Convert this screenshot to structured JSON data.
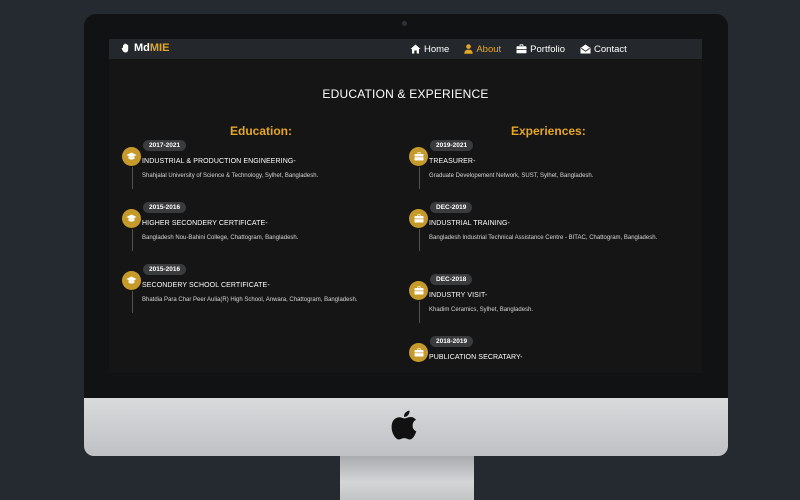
{
  "brand": {
    "prefix": "Md",
    "accent_text": "MIE",
    "icon": "hand-icon"
  },
  "nav": [
    {
      "label": "Home",
      "icon": "home-icon",
      "active": false
    },
    {
      "label": "About",
      "icon": "user-icon",
      "active": true
    },
    {
      "label": "Portfolio",
      "icon": "briefcase-icon",
      "active": false
    },
    {
      "label": "Contact",
      "icon": "envelope-open-icon",
      "active": false
    }
  ],
  "section_title": "EDUCATION & EXPERIENCE",
  "education": {
    "heading": "Education:",
    "items": [
      {
        "date": "2017-2021",
        "title": "INDUSTRIAL & PRODUCTION ENGINEERING-",
        "desc": "Shahjalal University of Science & Technology, Sylhet, Bangladesh.",
        "icon": "graduation-cap-icon"
      },
      {
        "date": "2015-2016",
        "title": "HIGHER SECONDERY CERTIFICATE-",
        "desc": "Bangladesh Nou-Bahini College, Chattogram, Bangladesh.",
        "icon": "graduation-cap-icon"
      },
      {
        "date": "2015-2016",
        "title": "SECONDERY SCHOOL CERTIFICATE-",
        "desc": "Bhatdia Para Char Peer Aulia(R) High School, Anwara, Chattogram, Bangladesh.",
        "icon": "graduation-cap-icon"
      }
    ]
  },
  "experience": {
    "heading": "Experiences:",
    "items": [
      {
        "date": "2019-2021",
        "title": "TREASURER-",
        "desc": "Graduate Developement Network, SUST, Sylhet, Bangladesh.",
        "icon": "briefcase-icon"
      },
      {
        "date": "DEC-2019",
        "title": "INDUSTRIAL TRAINING-",
        "desc": "Bangladesh Industrial Technical Assistance Centre - BITAC, Chattogram, Bangladesh.",
        "icon": "briefcase-icon"
      },
      {
        "date": "DEC-2018",
        "title": "INDUSTRY VISIT-",
        "desc": "Khadim Ceramics, Sylhet, Bangladesh.",
        "icon": "briefcase-icon"
      },
      {
        "date": "2018-2019",
        "title": "PUBLICATION SECRATARY-",
        "desc": "",
        "icon": "briefcase-icon"
      }
    ]
  },
  "colors": {
    "accent": "#e5a722",
    "icon_bg": "#c59a2a",
    "screen_bg": "#151515",
    "navbar_bg": "#24272b"
  }
}
